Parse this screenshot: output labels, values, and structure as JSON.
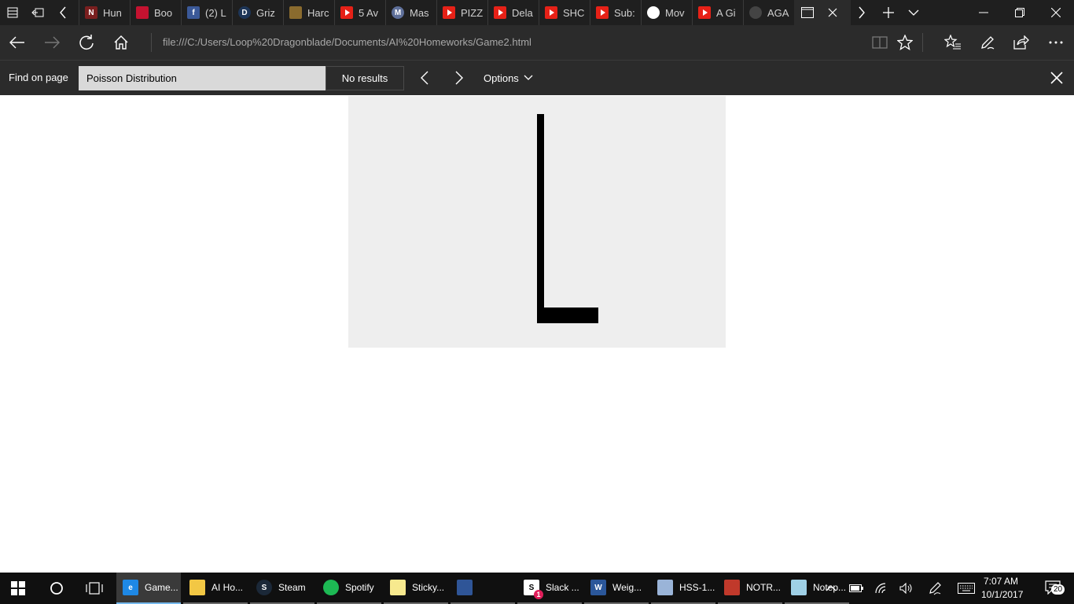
{
  "browser": {
    "tabs": [
      {
        "label": "Hun",
        "icon": "netflix-icon"
      },
      {
        "label": "Boo",
        "icon": "bookmark-icon"
      },
      {
        "label": "(2) L",
        "icon": "facebook-icon"
      },
      {
        "label": "Griz",
        "icon": "d-logo-icon"
      },
      {
        "label": "Harc",
        "icon": "game-icon"
      },
      {
        "label": "5 Av",
        "icon": "youtube-icon"
      },
      {
        "label": "Mas",
        "icon": "m-logo-icon"
      },
      {
        "label": "PIZZ",
        "icon": "youtube-icon"
      },
      {
        "label": "Dela",
        "icon": "youtube-icon"
      },
      {
        "label": "SHC",
        "icon": "youtube-icon"
      },
      {
        "label": "Sub:",
        "icon": "youtube-icon"
      },
      {
        "label": "Mov",
        "icon": "speech-bubble-icon"
      },
      {
        "label": "A Gi",
        "icon": "youtube-icon"
      },
      {
        "label": "AGA",
        "icon": "github-icon"
      }
    ],
    "url": "file:///C:/Users/Loop%20Dragonblade/Documents/AI%20Homeworks/Game2.html"
  },
  "find": {
    "label": "Find on page",
    "query": "Poisson Distribution",
    "results": "No results",
    "options_label": "Options"
  },
  "taskbar": {
    "apps": [
      {
        "label": "Game...",
        "icon": "edge-icon",
        "color": "#1e88e5"
      },
      {
        "label": "AI Ho...",
        "icon": "folder-icon",
        "color": "#f2c744"
      },
      {
        "label": "Steam",
        "icon": "steam-icon",
        "color": "#1b2838"
      },
      {
        "label": "Spotify",
        "icon": "spotify-icon",
        "color": "#1db954"
      },
      {
        "label": "Sticky...",
        "icon": "sticky-notes-icon",
        "color": "#f7e98e"
      },
      {
        "label": "",
        "icon": "calculator-icon",
        "color": "#2f5597"
      },
      {
        "label": "Slack ...",
        "icon": "slack-icon",
        "color": "#ffffff"
      },
      {
        "label": "Weig...",
        "icon": "word-icon",
        "color": "#2b579a"
      },
      {
        "label": "HSS-1...",
        "icon": "image-viewer-icon",
        "color": "#9ab4d8"
      },
      {
        "label": "NOTR...",
        "icon": "app-icon",
        "color": "#c0392b"
      },
      {
        "label": "Notep...",
        "icon": "notepad-icon",
        "color": "#9fd0e6"
      }
    ],
    "time": "7:07 AM",
    "date": "10/1/2017",
    "notifications": "20",
    "slack_badge": "1"
  }
}
